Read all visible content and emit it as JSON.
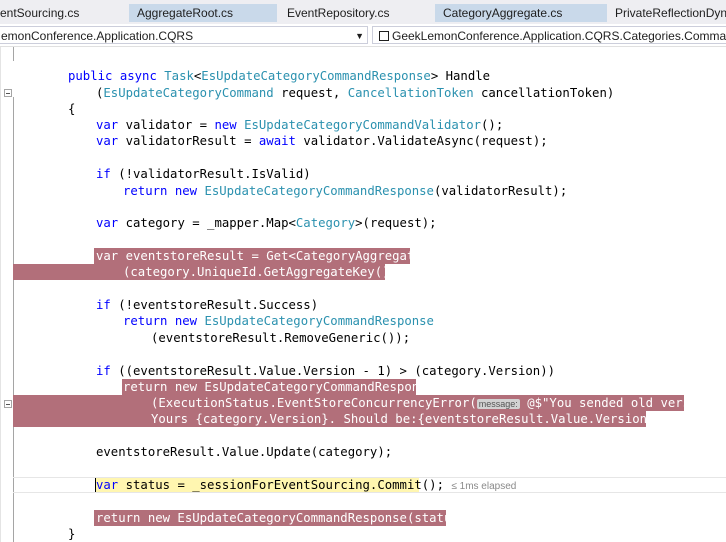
{
  "tabs": [
    {
      "label": "entSourcing.cs",
      "active": false
    },
    {
      "label": "AggregateRoot.cs",
      "active": true
    },
    {
      "label": "EventRepository.cs",
      "active": false
    },
    {
      "label": "CategoryAggregate.cs",
      "active": true
    },
    {
      "label": "PrivateReflectionDyn",
      "active": false
    }
  ],
  "navbar": {
    "project": "emonConference.Application.CQRS",
    "type": "GeekLemonConference.Application.CQRS.Categories.Command"
  },
  "code": {
    "l1": [
      "public",
      "async",
      "Task",
      "<",
      "EsUpdateCategoryCommandResponse",
      "> Handle"
    ],
    "l2": [
      "(",
      "EsUpdateCategoryCommand",
      " request, ",
      "CancellationToken",
      " cancellationToken)"
    ],
    "l3": [
      "{"
    ],
    "l4": [
      "var",
      " validator = ",
      "new",
      "EsUpdateCategoryCommandValidator",
      "();"
    ],
    "l5": [
      "var",
      " validatorResult = ",
      "await",
      " validator.ValidateAsync(request);"
    ],
    "l6": [
      "if",
      " (!validatorResult.IsValid)"
    ],
    "l7": [
      "return",
      "new",
      "EsUpdateCategoryCommandResponse",
      "(validatorResult);"
    ],
    "l8": [
      "var",
      " category = _mapper.Map<",
      "Category",
      ">(request);"
    ],
    "l9": [
      "var eventstoreResult = Get<CategoryAggregate>"
    ],
    "l10": [
      "(category.UniqueId.GetAggregateKey());"
    ],
    "l11": [
      "if",
      " (!eventstoreResult.Success)"
    ],
    "l12": [
      "return",
      "new",
      "EsUpdateCategoryCommandResponse"
    ],
    "l13": [
      "(eventstoreResult.RemoveGeneric());"
    ],
    "l14": [
      "if",
      " ((eventstoreResult.Value.Version - 1) > (category.Version))"
    ],
    "l15": [
      "return new EsUpdateCategoryCommandResponse"
    ],
    "l16": [
      "(",
      "ExecutionStatus",
      ".EventStoreConcurrencyError(",
      "message:",
      " @$\"You sended old version."
    ],
    "l17": [
      "Yours {category.Version}. Should be:{eventstoreResult.Value.Version}\"));"
    ],
    "l18": [
      "eventstoreResult.Value.Update(category);"
    ],
    "l19": [
      "var",
      " status = _sessionForEventSourcing.Commit();",
      "≤ 1ms elapsed"
    ],
    "l20": [
      "return new EsUpdateCategoryCommandResponse(status);"
    ],
    "l21": [
      "}"
    ]
  },
  "colors": {
    "keyword": "#0000ff",
    "type": "#2b91af",
    "breakpoint": "#b26f7a",
    "current_statement": "#fff6b0"
  }
}
